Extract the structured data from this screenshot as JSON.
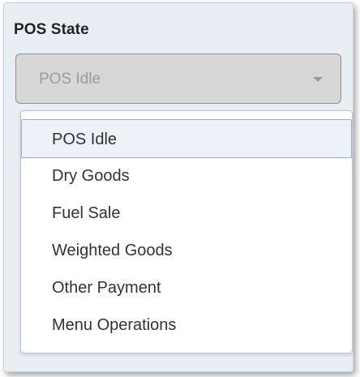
{
  "pos_state": {
    "label": "POS State",
    "selected_value": "POS Idle",
    "options": [
      {
        "label": "POS Idle"
      },
      {
        "label": "Dry Goods"
      },
      {
        "label": "Fuel Sale"
      },
      {
        "label": "Weighted Goods"
      },
      {
        "label": "Other Payment"
      },
      {
        "label": "Menu Operations"
      }
    ]
  },
  "colors": {
    "panel_background": "#e9eef4",
    "select_background": "#d7d7d7",
    "option_highlight_border": "#8fb2e8",
    "option_highlight_background": "#eef2f8"
  },
  "icons": {
    "select_caret": "chevron-down-icon"
  }
}
